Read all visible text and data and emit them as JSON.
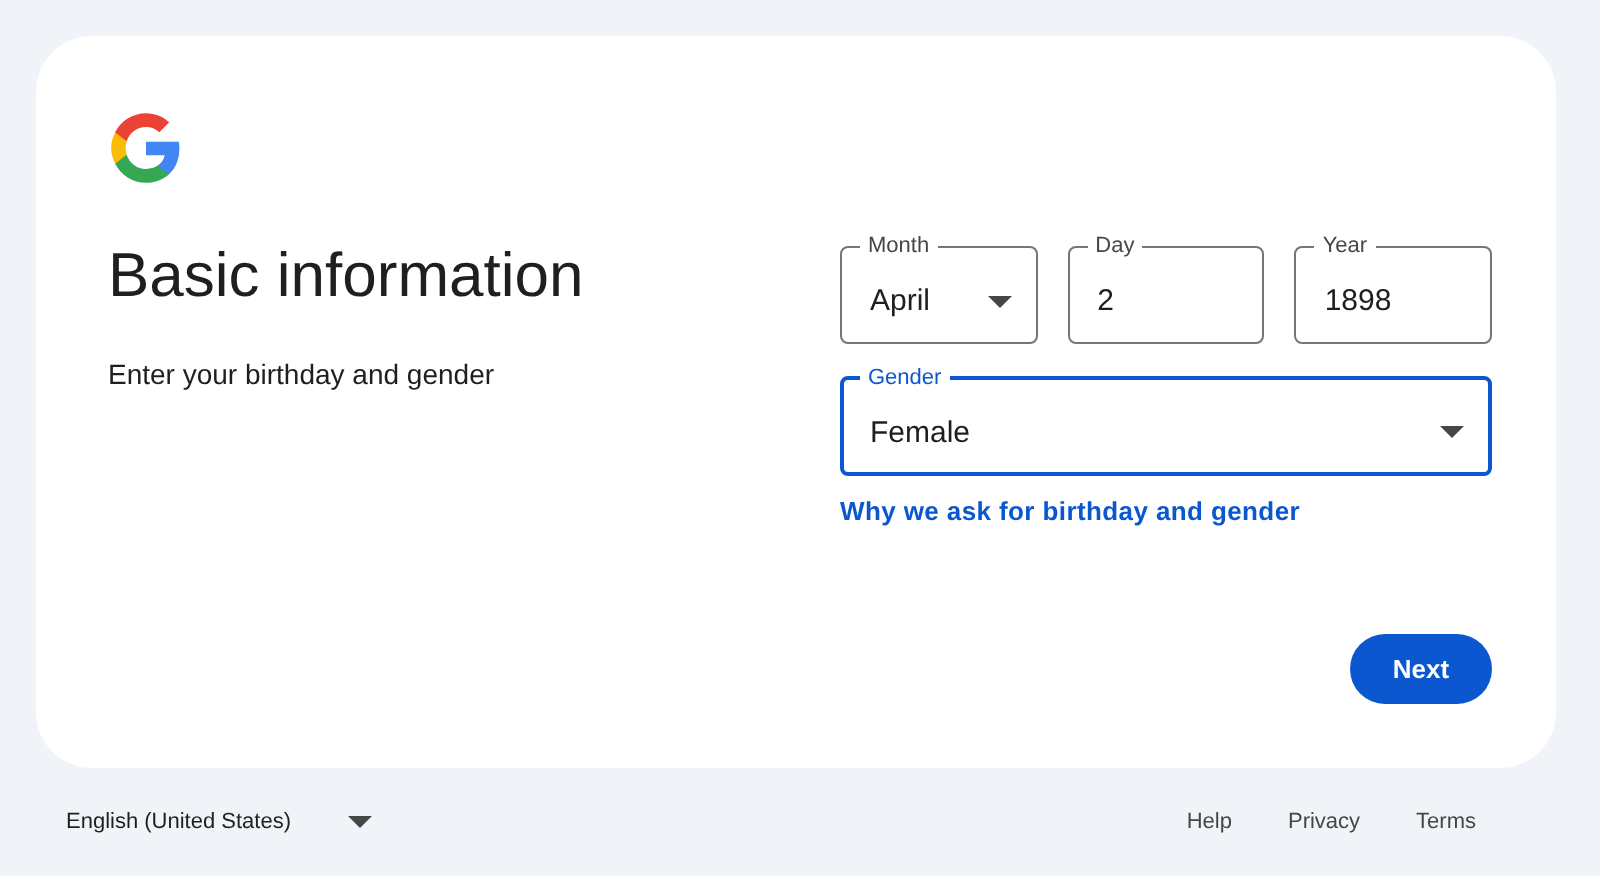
{
  "title": "Basic information",
  "subtitle": "Enter your birthday and gender",
  "fields": [
    {
      "label": "Month",
      "value": "April",
      "kind": "select",
      "focused": false
    },
    {
      "label": "Day",
      "value": "2",
      "kind": "text",
      "focused": false
    },
    {
      "label": "Year",
      "value": "1898",
      "kind": "text",
      "focused": false
    }
  ],
  "gender": {
    "label": "Gender",
    "value": "Female",
    "kind": "select",
    "focused": true
  },
  "link": "Why we ask for birthday and gender",
  "next_button": "Next",
  "footer": {
    "language": "English (United States)",
    "links": [
      "Help",
      "Privacy",
      "Terms"
    ]
  }
}
